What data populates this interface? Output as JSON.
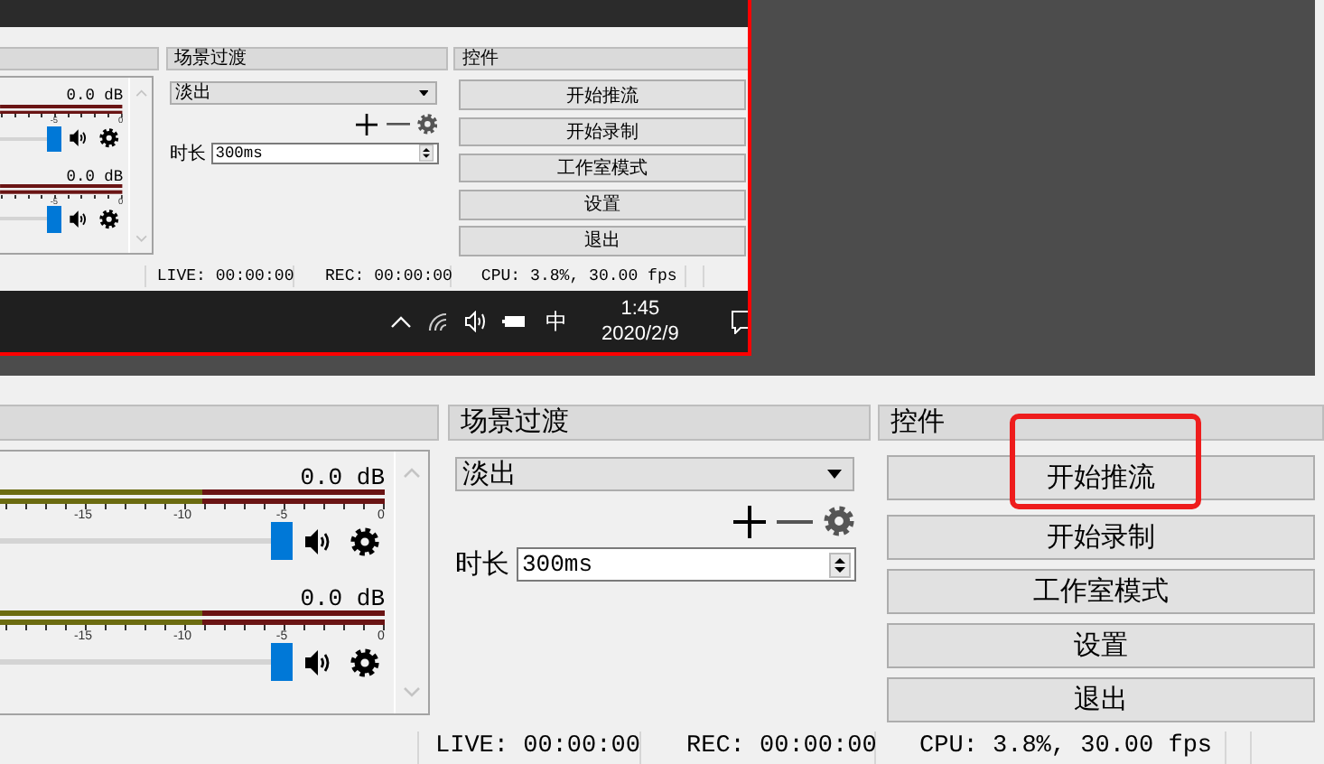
{
  "preview": {
    "capture": {
      "dock": {
        "mixer": {
          "channels": [
            {
              "reading": "0.0 dB",
              "level": 1,
              "scale": [
                "-5",
                "0"
              ]
            },
            {
              "reading": "0.0 dB",
              "level": 1,
              "scale": [
                "-5",
                "0"
              ]
            }
          ]
        },
        "transitions": {
          "title": "场景过渡",
          "transition": "淡出",
          "duration_label": "时长",
          "duration": "300ms"
        },
        "controls": {
          "title": "控件",
          "buttons": [
            {
              "label": "开始推流",
              "highlighted": false
            },
            {
              "label": "开始录制",
              "highlighted": false
            },
            {
              "label": "工作室模式",
              "highlighted": false
            },
            {
              "label": "设置",
              "highlighted": false
            },
            {
              "label": "退出",
              "highlighted": false
            }
          ]
        },
        "status_bar": [
          "LIVE: 00:00:00",
          "REC: 00:00:00",
          "CPU: 3.8%, 30.00 fps"
        ]
      },
      "taskbar": {
        "input_method": "中",
        "time": "1:45",
        "date": "2020/2/9"
      }
    }
  },
  "dock": {
    "mixer": {
      "channels": [
        {
          "reading": "0.0 dB",
          "level": 1,
          "scale": [
            "-15",
            "-10",
            "-5",
            "0"
          ]
        },
        {
          "reading": "0.0 dB",
          "level": 1,
          "scale": [
            "-15",
            "-10",
            "-5",
            "0"
          ]
        }
      ]
    },
    "transitions": {
      "title": "场景过渡",
      "transition": "淡出",
      "duration_label": "时长",
      "duration": "300ms"
    },
    "controls": {
      "title": "控件",
      "buttons": [
        {
          "label": "开始推流",
          "highlighted": true
        },
        {
          "label": "开始录制",
          "highlighted": false
        },
        {
          "label": "工作室模式",
          "highlighted": false
        },
        {
          "label": "设置",
          "highlighted": false
        },
        {
          "label": "退出",
          "highlighted": false
        }
      ]
    },
    "status_bar": [
      "LIVE: 00:00:00",
      "REC: 00:00:00",
      "CPU: 3.8%, 30.00 fps"
    ]
  }
}
